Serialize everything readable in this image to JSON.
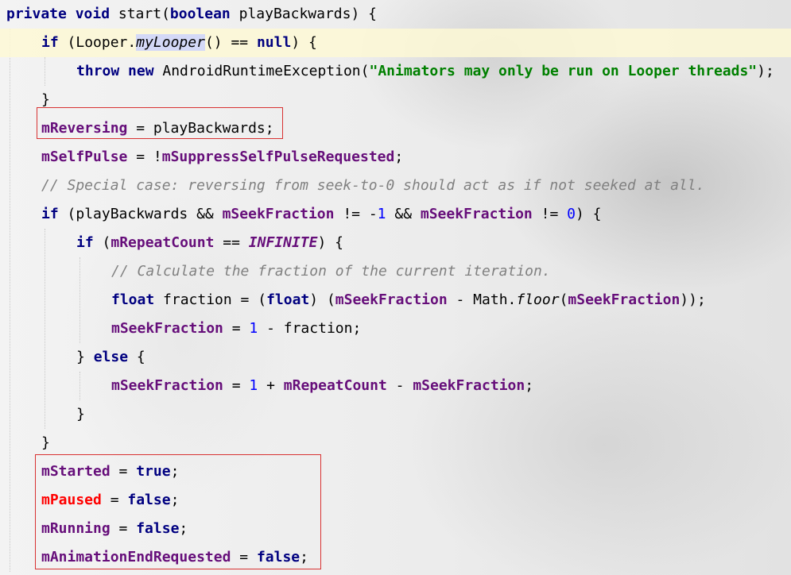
{
  "colors": {
    "keyword": "#000080",
    "field": "#660e7a",
    "field_red": "#ff0000",
    "number": "#0000ff",
    "string": "#008000",
    "comment": "#808080",
    "line_highlight": "#fdf8d5",
    "box_border": "#d83232"
  },
  "lines": [
    [
      [
        "kw",
        "private void"
      ],
      [
        "p",
        " start("
      ],
      [
        "kw",
        "boolean"
      ],
      [
        "p",
        " playBackwards) {"
      ]
    ],
    [
      [
        "kw",
        "if"
      ],
      [
        "p",
        " (Looper."
      ],
      [
        "staticm",
        "myLooper"
      ],
      [
        "p",
        "() == "
      ],
      [
        "kw",
        "null"
      ],
      [
        "p",
        ") {"
      ]
    ],
    [
      [
        "kw",
        "throw new"
      ],
      [
        "p",
        " AndroidRuntimeException("
      ],
      [
        "str",
        "\"Animators may only be run on Looper threads\""
      ],
      [
        "p",
        ");"
      ]
    ],
    [
      [
        "p",
        "}"
      ]
    ],
    [
      [
        "fld",
        "mReversing"
      ],
      [
        "p",
        " = playBackwards;"
      ]
    ],
    [
      [
        "fld",
        "mSelfPulse"
      ],
      [
        "p",
        " = !"
      ],
      [
        "fld",
        "mSuppressSelfPulseRequested"
      ],
      [
        "p",
        ";"
      ]
    ],
    [
      [
        "cmt",
        "// Special case: reversing from seek-to-0 should act as if not seeked at all."
      ]
    ],
    [
      [
        "kw",
        "if"
      ],
      [
        "p",
        " (playBackwards && "
      ],
      [
        "fld",
        "mSeekFraction"
      ],
      [
        "p",
        " != -"
      ],
      [
        "num",
        "1"
      ],
      [
        "p",
        " && "
      ],
      [
        "fld",
        "mSeekFraction"
      ],
      [
        "p",
        " != "
      ],
      [
        "num",
        "0"
      ],
      [
        "p",
        ") {"
      ]
    ],
    [
      [
        "kw",
        "if"
      ],
      [
        "p",
        " ("
      ],
      [
        "fld",
        "mRepeatCount"
      ],
      [
        "p",
        " == "
      ],
      [
        "const",
        "INFINITE"
      ],
      [
        "p",
        ") {"
      ]
    ],
    [
      [
        "cmt",
        "// Calculate the fraction of the current iteration."
      ]
    ],
    [
      [
        "kw",
        "float"
      ],
      [
        "p",
        " fraction = ("
      ],
      [
        "kw",
        "float"
      ],
      [
        "p",
        ") ("
      ],
      [
        "fld",
        "mSeekFraction"
      ],
      [
        "p",
        " - Math."
      ],
      [
        "staticm",
        "floor"
      ],
      [
        "p",
        "("
      ],
      [
        "fld",
        "mSeekFraction"
      ],
      [
        "p",
        "));"
      ]
    ],
    [
      [
        "fld",
        "mSeekFraction"
      ],
      [
        "p",
        " = "
      ],
      [
        "num",
        "1"
      ],
      [
        "p",
        " - fraction;"
      ]
    ],
    [
      [
        "p",
        "} "
      ],
      [
        "kw",
        "else"
      ],
      [
        "p",
        " {"
      ]
    ],
    [
      [
        "fld",
        "mSeekFraction"
      ],
      [
        "p",
        " = "
      ],
      [
        "num",
        "1"
      ],
      [
        "p",
        " + "
      ],
      [
        "fld",
        "mRepeatCount"
      ],
      [
        "p",
        " - "
      ],
      [
        "fld",
        "mSeekFraction"
      ],
      [
        "p",
        ";"
      ]
    ],
    [
      [
        "p",
        "}"
      ]
    ],
    [
      [
        "p",
        "}"
      ]
    ],
    [
      [
        "fld",
        "mStarted"
      ],
      [
        "p",
        " = "
      ],
      [
        "kw",
        "true"
      ],
      [
        "p",
        ";"
      ]
    ],
    [
      [
        "fldred",
        "mPaused"
      ],
      [
        "p",
        " = "
      ],
      [
        "kw",
        "false"
      ],
      [
        "p",
        ";"
      ]
    ],
    [
      [
        "fld",
        "mRunning"
      ],
      [
        "p",
        " = "
      ],
      [
        "kw",
        "false"
      ],
      [
        "p",
        ";"
      ]
    ],
    [
      [
        "fld",
        "mAnimationEndRequested"
      ],
      [
        "p",
        " = "
      ],
      [
        "kw",
        "false"
      ],
      [
        "p",
        ";"
      ]
    ]
  ]
}
